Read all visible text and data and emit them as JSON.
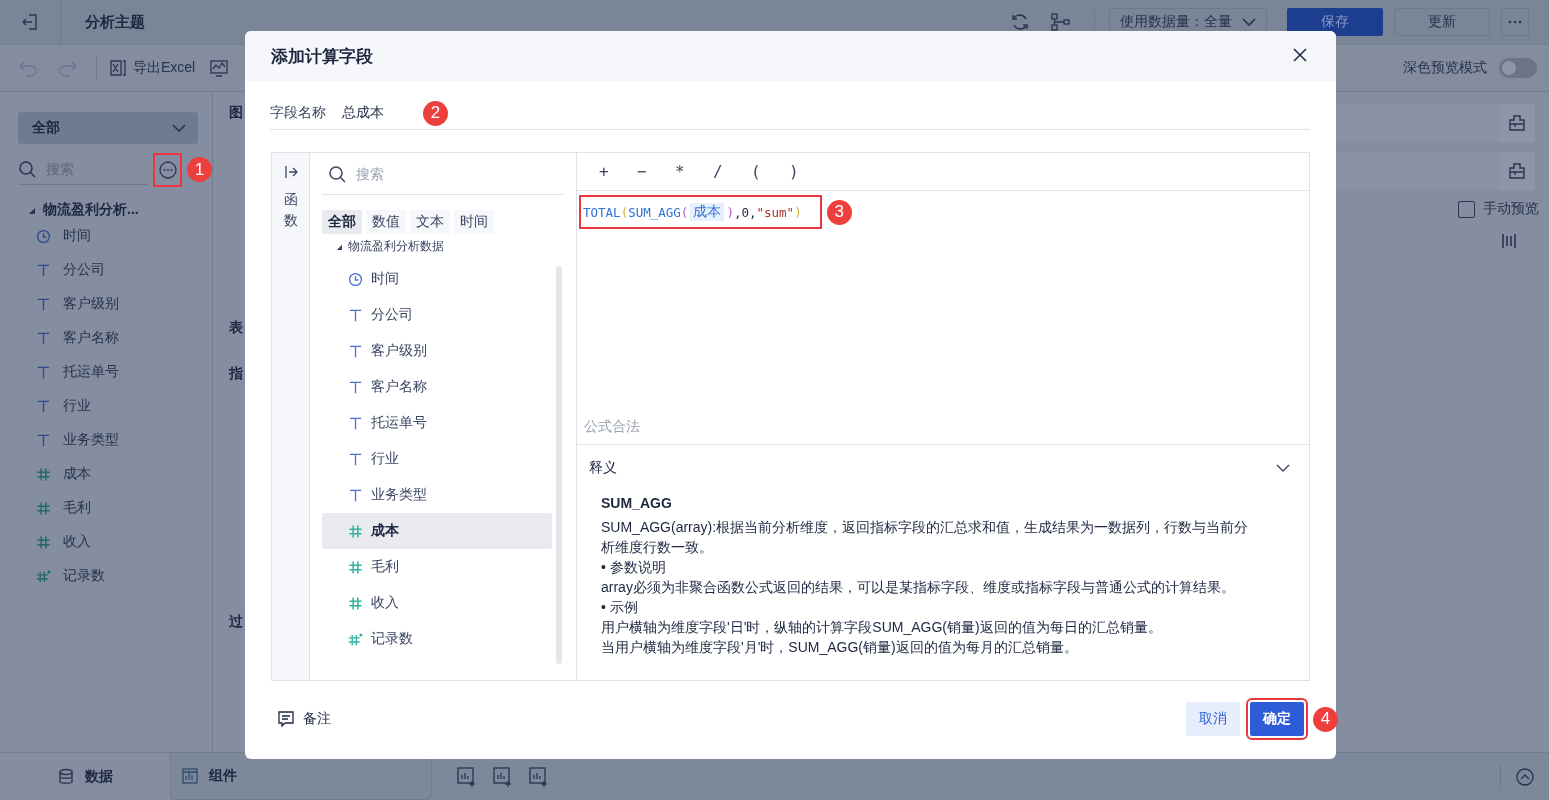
{
  "top_bar": {
    "title": "分析主题",
    "data_volume": "使用数据量：全量",
    "buttons": [
      {
        "label": "保存",
        "kind": "primary"
      },
      {
        "label": "更新",
        "kind": "default"
      }
    ]
  },
  "toolbar": {
    "export": "导出Excel",
    "dark_preview": {
      "label": "深色预览模式",
      "on": false
    }
  },
  "left_panel": {
    "scope": "全部",
    "search": {
      "placeholder": "搜索"
    },
    "more_button": {
      "callout": "1"
    },
    "tree": {
      "label": "物流盈利分析...",
      "expanded": true,
      "children": [
        {
          "label": "时间",
          "kind": "time"
        },
        {
          "label": "分公司",
          "kind": "text"
        },
        {
          "label": "客户级别",
          "kind": "text"
        },
        {
          "label": "客户名称",
          "kind": "text"
        },
        {
          "label": "托运单号",
          "kind": "text"
        },
        {
          "label": "行业",
          "kind": "text"
        },
        {
          "label": "业务类型",
          "kind": "text"
        },
        {
          "label": "成本",
          "kind": "number"
        },
        {
          "label": "毛利",
          "kind": "number"
        },
        {
          "label": "收入",
          "kind": "number"
        },
        {
          "label": "记录数",
          "kind": "count"
        }
      ]
    }
  },
  "middle_column": {
    "headings": [
      "图",
      "表",
      "指",
      "过"
    ]
  },
  "right_panel": {
    "manual_preview": {
      "label": "手动预览",
      "checked": false
    }
  },
  "bottom_bar": {
    "tabs": [
      {
        "label": "数据",
        "selected": true
      },
      {
        "label": "组件",
        "selected": false
      }
    ]
  },
  "dialog": {
    "title": "添加计算字段",
    "field_name": {
      "label": "字段名称",
      "value": "总成本",
      "callout": "2"
    },
    "side_tab": "函数",
    "field_list": {
      "search": {
        "placeholder": "搜索"
      },
      "filters": [
        {
          "label": "全部",
          "selected": true
        },
        {
          "label": "数值",
          "selected": false
        },
        {
          "label": "文本",
          "selected": false
        },
        {
          "label": "时间",
          "selected": false
        }
      ],
      "group": "物流盈利分析数据",
      "items": [
        {
          "label": "时间",
          "kind": "time",
          "selected": false
        },
        {
          "label": "分公司",
          "kind": "text",
          "selected": false
        },
        {
          "label": "客户级别",
          "kind": "text",
          "selected": false
        },
        {
          "label": "客户名称",
          "kind": "text",
          "selected": false
        },
        {
          "label": "托运单号",
          "kind": "text",
          "selected": false
        },
        {
          "label": "行业",
          "kind": "text",
          "selected": false
        },
        {
          "label": "业务类型",
          "kind": "text",
          "selected": false
        },
        {
          "label": "成本",
          "kind": "number",
          "selected": true
        },
        {
          "label": "毛利",
          "kind": "number",
          "selected": false
        },
        {
          "label": "收入",
          "kind": "number",
          "selected": false
        },
        {
          "label": "记录数",
          "kind": "count",
          "selected": false
        }
      ]
    },
    "operators": [
      "+",
      "−",
      "*",
      "/",
      "(",
      ")"
    ],
    "formula": {
      "callout": "3",
      "tokens": [
        {
          "text": "TOTAL",
          "kind": "function"
        },
        {
          "text": "(",
          "kind": "bracket-outer"
        },
        {
          "text": "SUM_AGG",
          "kind": "function"
        },
        {
          "text": "(",
          "kind": "bracket-inner"
        },
        {
          "text": "成本",
          "kind": "field"
        },
        {
          "text": ")",
          "kind": "bracket-inner"
        },
        {
          "text": ",0,",
          "kind": "plain"
        },
        {
          "text": "\"sum\"",
          "kind": "string"
        },
        {
          "text": ")",
          "kind": "bracket-outer"
        }
      ]
    },
    "status": "公式合法",
    "explanation": {
      "heading": "释义",
      "expanded": true,
      "title": "SUM_AGG",
      "lines": [
        "SUM_AGG(array):根据当前分析维度，返回指标字段的汇总求和值，生成结果为一数据列，行数与当前分析维度行数一致。",
        "• 参数说明",
        "array必须为非聚合函数公式返回的结果，可以是某指标字段、维度或指标字段与普通公式的计算结果。",
        "• 示例",
        "用户横轴为维度字段'日'时，纵轴的计算字段SUM_AGG(销量)返回的值为每日的汇总销量。",
        "当用户横轴为维度字段'月'时，SUM_AGG(销量)返回的值为每月的汇总销量。"
      ]
    },
    "note": "备注",
    "buttons": [
      {
        "label": "取消",
        "kind": "secondary"
      },
      {
        "label": "确定",
        "kind": "primary",
        "callout": "4"
      }
    ]
  }
}
